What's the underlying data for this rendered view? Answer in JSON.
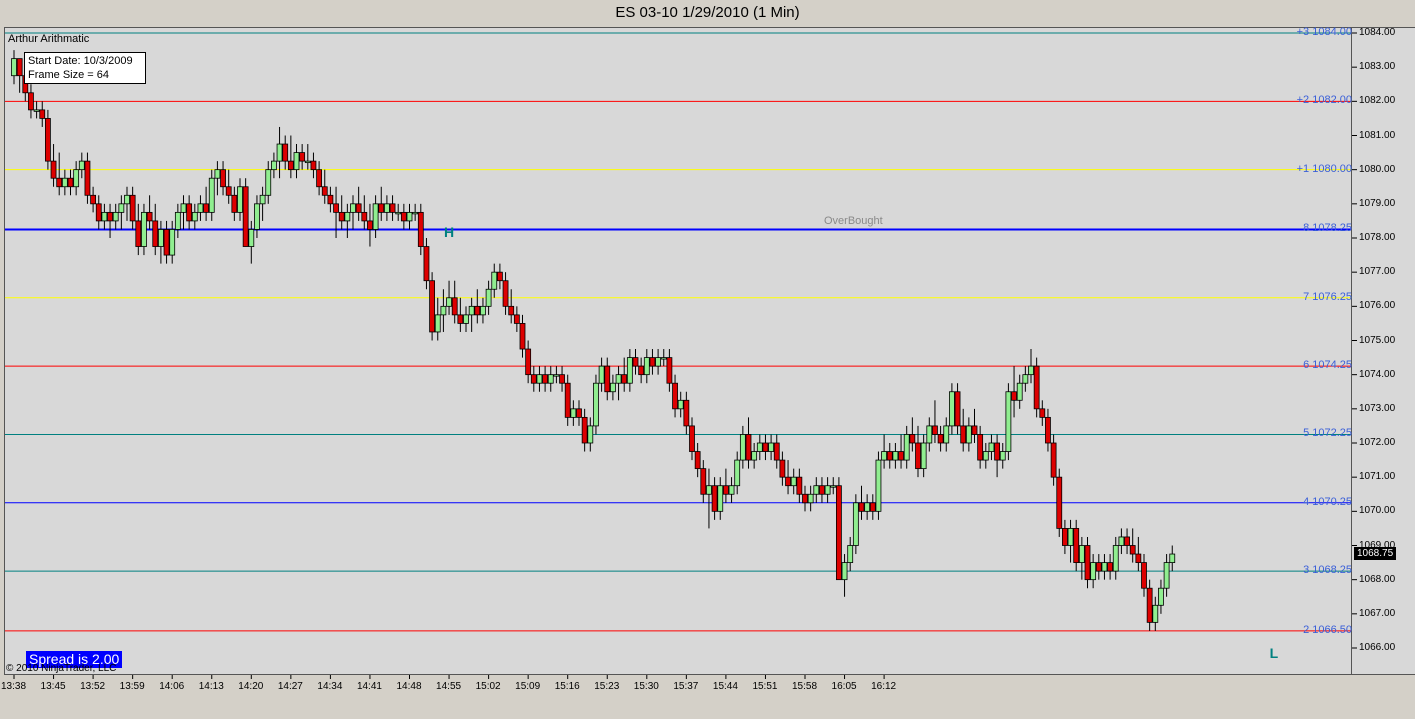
{
  "window_title": "ES 03-10  1/29/2010 (1 Min)",
  "indicator_name": "Arthur Arithmatic",
  "info_box": {
    "start_date": "Start Date: 10/3/2009",
    "frame_size": "Frame Size = 64"
  },
  "spread": "Spread is 2.00",
  "copyright": "© 2010 NinjaTrader, LLC",
  "overbought_label": "OverBought",
  "last_price": "1068.75",
  "colors": {
    "up_candle": "#90ee90",
    "down_candle": "#dd0000",
    "label_text": "#3a5fd8",
    "marker_text": "#008080"
  },
  "chart_data": {
    "type": "candlestick",
    "title": "ES 03-10  1/29/2010 (1 Min)",
    "ylim": [
      1065.5,
      1084.0
    ],
    "y_ticks": [
      "1084.00",
      "1083.00",
      "1082.00",
      "1081.00",
      "1080.00",
      "1079.00",
      "1078.00",
      "1077.00",
      "1076.00",
      "1075.00",
      "1074.00",
      "1073.00",
      "1072.00",
      "1071.00",
      "1070.00",
      "1069.00",
      "1068.00",
      "1067.00",
      "1066.00"
    ],
    "x_ticks": [
      "13:38",
      "13:45",
      "13:52",
      "13:59",
      "14:06",
      "14:13",
      "14:20",
      "14:27",
      "14:34",
      "14:41",
      "14:48",
      "14:55",
      "15:02",
      "15:09",
      "15:16",
      "15:23",
      "15:30",
      "15:37",
      "15:44",
      "15:51",
      "15:58",
      "16:05",
      "16:12"
    ],
    "levels": [
      {
        "label": "+3 1084.00",
        "value": 1084.0,
        "color": "#008080",
        "width": 1
      },
      {
        "label": "+2 1082.00",
        "value": 1082.0,
        "color": "#ff0000",
        "width": 1
      },
      {
        "label": "+1 1080.00",
        "value": 1080.0,
        "color": "#ffff00",
        "width": 1
      },
      {
        "label": "8 1078.25",
        "value": 1078.25,
        "color": "#0000ff",
        "width": 2
      },
      {
        "label": "7 1076.25",
        "value": 1076.25,
        "color": "#ffff00",
        "width": 1
      },
      {
        "label": "6 1074.25",
        "value": 1074.25,
        "color": "#ff0000",
        "width": 1
      },
      {
        "label": "5 1072.25",
        "value": 1072.25,
        "color": "#008080",
        "width": 1
      },
      {
        "label": "4 1070.25",
        "value": 1070.25,
        "color": "#0000ff",
        "width": 1
      },
      {
        "label": "3 1068.25",
        "value": 1068.25,
        "color": "#008080",
        "width": 1
      },
      {
        "label": "2 1066.50",
        "value": 1066.5,
        "color": "#ff0000",
        "width": 1
      }
    ],
    "markers": [
      {
        "text": "H",
        "bar": 77,
        "value": 1078.0
      },
      {
        "text": "L",
        "bar": 223,
        "value": 1066.0
      }
    ],
    "bar_interval_minutes": 1,
    "ohlc": [
      [
        1082.75,
        1083.5,
        1082.5,
        1083.25
      ],
      [
        1083.25,
        1083.25,
        1082.25,
        1082.75
      ],
      [
        1082.75,
        1083.0,
        1082.0,
        1082.25
      ],
      [
        1082.25,
        1082.5,
        1081.5,
        1081.75
      ],
      [
        1081.75,
        1082.0,
        1081.5,
        1081.75
      ],
      [
        1081.75,
        1082.0,
        1081.25,
        1081.5
      ],
      [
        1081.5,
        1081.75,
        1080.0,
        1080.25
      ],
      [
        1080.25,
        1080.75,
        1079.5,
        1079.75
      ],
      [
        1079.75,
        1080.5,
        1079.25,
        1079.5
      ],
      [
        1079.5,
        1080.0,
        1079.25,
        1079.75
      ],
      [
        1079.75,
        1080.0,
        1079.25,
        1079.5
      ],
      [
        1079.5,
        1080.25,
        1079.25,
        1080.0
      ],
      [
        1080.0,
        1080.5,
        1079.75,
        1080.25
      ],
      [
        1080.25,
        1080.5,
        1079.0,
        1079.25
      ],
      [
        1079.25,
        1079.5,
        1078.75,
        1079.0
      ],
      [
        1079.0,
        1079.25,
        1078.25,
        1078.5
      ],
      [
        1078.5,
        1079.0,
        1078.25,
        1078.75
      ],
      [
        1078.75,
        1079.0,
        1078.0,
        1078.5
      ],
      [
        1078.5,
        1079.0,
        1078.25,
        1078.75
      ],
      [
        1078.75,
        1079.25,
        1078.25,
        1079.0
      ],
      [
        1079.0,
        1079.5,
        1078.5,
        1079.25
      ],
      [
        1079.25,
        1079.5,
        1078.25,
        1078.5
      ],
      [
        1078.5,
        1079.0,
        1077.5,
        1077.75
      ],
      [
        1077.75,
        1079.0,
        1077.5,
        1078.75
      ],
      [
        1078.75,
        1079.25,
        1078.25,
        1078.5
      ],
      [
        1078.5,
        1079.0,
        1077.5,
        1077.75
      ],
      [
        1077.75,
        1078.5,
        1077.25,
        1078.25
      ],
      [
        1078.25,
        1078.5,
        1077.25,
        1077.5
      ],
      [
        1077.5,
        1078.5,
        1077.25,
        1078.25
      ],
      [
        1078.25,
        1079.0,
        1078.0,
        1078.75
      ],
      [
        1078.75,
        1079.25,
        1078.25,
        1079.0
      ],
      [
        1079.0,
        1079.25,
        1078.25,
        1078.5
      ],
      [
        1078.5,
        1079.0,
        1078.25,
        1078.75
      ],
      [
        1078.75,
        1079.25,
        1078.5,
        1079.0
      ],
      [
        1079.0,
        1079.5,
        1078.5,
        1078.75
      ],
      [
        1078.75,
        1080.0,
        1078.5,
        1079.75
      ],
      [
        1079.75,
        1080.25,
        1079.25,
        1080.0
      ],
      [
        1080.0,
        1080.25,
        1079.25,
        1079.5
      ],
      [
        1079.5,
        1080.0,
        1079.0,
        1079.25
      ],
      [
        1079.25,
        1079.5,
        1078.5,
        1078.75
      ],
      [
        1078.75,
        1079.75,
        1078.5,
        1079.5
      ],
      [
        1079.5,
        1079.75,
        1077.75,
        1077.75
      ],
      [
        1077.75,
        1078.5,
        1077.25,
        1078.25
      ],
      [
        1078.25,
        1079.25,
        1078.0,
        1079.0
      ],
      [
        1079.0,
        1079.5,
        1078.5,
        1079.25
      ],
      [
        1079.25,
        1080.25,
        1079.0,
        1080.0
      ],
      [
        1080.0,
        1080.5,
        1079.75,
        1080.25
      ],
      [
        1080.25,
        1081.25,
        1079.75,
        1080.75
      ],
      [
        1080.75,
        1081.0,
        1080.0,
        1080.25
      ],
      [
        1080.25,
        1081.0,
        1079.75,
        1080.0
      ],
      [
        1080.0,
        1080.75,
        1079.75,
        1080.5
      ],
      [
        1080.5,
        1080.75,
        1080.0,
        1080.25
      ],
      [
        1080.25,
        1080.75,
        1080.0,
        1080.25
      ],
      [
        1080.25,
        1080.5,
        1079.75,
        1080.0
      ],
      [
        1080.0,
        1080.25,
        1079.25,
        1079.5
      ],
      [
        1079.5,
        1080.0,
        1079.0,
        1079.25
      ],
      [
        1079.25,
        1079.5,
        1078.75,
        1079.0
      ],
      [
        1079.0,
        1079.5,
        1078.0,
        1078.75
      ],
      [
        1078.75,
        1079.25,
        1078.25,
        1078.5
      ],
      [
        1078.5,
        1079.0,
        1078.0,
        1078.75
      ],
      [
        1078.75,
        1079.25,
        1078.25,
        1079.0
      ],
      [
        1079.0,
        1079.5,
        1078.5,
        1078.75
      ],
      [
        1078.75,
        1079.25,
        1078.25,
        1078.5
      ],
      [
        1078.5,
        1079.0,
        1077.75,
        1078.25
      ],
      [
        1078.25,
        1079.25,
        1078.0,
        1079.0
      ],
      [
        1079.0,
        1079.5,
        1078.5,
        1078.75
      ],
      [
        1078.75,
        1079.25,
        1078.5,
        1079.0
      ],
      [
        1079.0,
        1079.25,
        1078.5,
        1078.75
      ],
      [
        1078.75,
        1079.0,
        1078.5,
        1078.75
      ],
      [
        1078.75,
        1079.0,
        1078.25,
        1078.5
      ],
      [
        1078.5,
        1079.0,
        1078.25,
        1078.75
      ],
      [
        1078.75,
        1079.0,
        1078.5,
        1078.75
      ],
      [
        1078.75,
        1079.0,
        1077.5,
        1077.75
      ],
      [
        1077.75,
        1078.0,
        1076.5,
        1076.75
      ],
      [
        1076.75,
        1077.0,
        1075.0,
        1075.25
      ],
      [
        1075.25,
        1076.25,
        1075.0,
        1075.75
      ],
      [
        1075.75,
        1076.5,
        1075.25,
        1076.0
      ],
      [
        1076.0,
        1076.75,
        1075.75,
        1076.25
      ],
      [
        1076.25,
        1076.75,
        1075.5,
        1075.75
      ],
      [
        1075.75,
        1076.25,
        1075.25,
        1075.5
      ],
      [
        1075.5,
        1076.0,
        1075.25,
        1075.75
      ],
      [
        1075.75,
        1076.25,
        1075.25,
        1076.0
      ],
      [
        1076.0,
        1076.5,
        1075.5,
        1075.75
      ],
      [
        1075.75,
        1076.25,
        1075.5,
        1076.0
      ],
      [
        1076.0,
        1076.75,
        1075.75,
        1076.5
      ],
      [
        1076.5,
        1077.25,
        1076.25,
        1077.0
      ],
      [
        1077.0,
        1077.25,
        1076.5,
        1076.75
      ],
      [
        1076.75,
        1077.0,
        1075.75,
        1076.0
      ],
      [
        1076.0,
        1076.5,
        1075.5,
        1075.75
      ],
      [
        1075.75,
        1076.0,
        1075.25,
        1075.5
      ],
      [
        1075.5,
        1075.75,
        1074.5,
        1074.75
      ],
      [
        1074.75,
        1075.0,
        1073.75,
        1074.0
      ],
      [
        1074.0,
        1074.25,
        1073.5,
        1073.75
      ],
      [
        1073.75,
        1074.25,
        1073.5,
        1074.0
      ],
      [
        1074.0,
        1074.25,
        1073.5,
        1073.75
      ],
      [
        1073.75,
        1074.25,
        1073.5,
        1074.0
      ],
      [
        1074.0,
        1074.25,
        1073.75,
        1074.0
      ],
      [
        1074.0,
        1074.25,
        1073.5,
        1073.75
      ],
      [
        1073.75,
        1074.0,
        1072.5,
        1072.75
      ],
      [
        1072.75,
        1073.25,
        1072.5,
        1073.0
      ],
      [
        1073.0,
        1073.25,
        1072.5,
        1072.75
      ],
      [
        1072.75,
        1073.0,
        1071.75,
        1072.0
      ],
      [
        1072.0,
        1072.75,
        1071.75,
        1072.5
      ],
      [
        1072.5,
        1074.0,
        1072.25,
        1073.75
      ],
      [
        1073.75,
        1074.5,
        1073.5,
        1074.25
      ],
      [
        1074.25,
        1074.5,
        1073.25,
        1073.5
      ],
      [
        1073.5,
        1074.0,
        1073.25,
        1073.75
      ],
      [
        1073.75,
        1074.25,
        1073.25,
        1074.0
      ],
      [
        1074.0,
        1074.5,
        1073.5,
        1073.75
      ],
      [
        1073.75,
        1074.75,
        1073.5,
        1074.5
      ],
      [
        1074.5,
        1074.75,
        1074.0,
        1074.25
      ],
      [
        1074.25,
        1074.5,
        1073.75,
        1074.0
      ],
      [
        1074.0,
        1074.75,
        1073.75,
        1074.5
      ],
      [
        1074.5,
        1074.75,
        1074.0,
        1074.25
      ],
      [
        1074.25,
        1074.75,
        1074.0,
        1074.5
      ],
      [
        1074.5,
        1074.75,
        1074.25,
        1074.5
      ],
      [
        1074.5,
        1074.75,
        1073.5,
        1073.75
      ],
      [
        1073.75,
        1074.0,
        1072.75,
        1073.0
      ],
      [
        1073.0,
        1073.5,
        1072.75,
        1073.25
      ],
      [
        1073.25,
        1073.5,
        1072.25,
        1072.5
      ],
      [
        1072.5,
        1072.75,
        1071.5,
        1071.75
      ],
      [
        1071.75,
        1072.0,
        1071.0,
        1071.25
      ],
      [
        1071.25,
        1071.5,
        1070.25,
        1070.5
      ],
      [
        1070.5,
        1071.25,
        1069.5,
        1070.75
      ],
      [
        1070.75,
        1071.0,
        1069.75,
        1070.0
      ],
      [
        1070.0,
        1071.0,
        1069.75,
        1070.75
      ],
      [
        1070.75,
        1071.25,
        1070.25,
        1070.5
      ],
      [
        1070.5,
        1071.0,
        1070.25,
        1070.75
      ],
      [
        1070.75,
        1071.75,
        1070.5,
        1071.5
      ],
      [
        1071.5,
        1072.5,
        1071.25,
        1072.25
      ],
      [
        1072.25,
        1072.75,
        1071.25,
        1071.5
      ],
      [
        1071.5,
        1072.0,
        1071.25,
        1071.75
      ],
      [
        1071.75,
        1072.25,
        1071.5,
        1072.0
      ],
      [
        1072.0,
        1072.25,
        1071.5,
        1071.75
      ],
      [
        1071.75,
        1072.25,
        1071.5,
        1072.0
      ],
      [
        1072.0,
        1072.25,
        1071.25,
        1071.5
      ],
      [
        1071.5,
        1071.75,
        1070.75,
        1071.0
      ],
      [
        1071.0,
        1071.5,
        1070.5,
        1070.75
      ],
      [
        1070.75,
        1071.25,
        1070.5,
        1071.0
      ],
      [
        1071.0,
        1071.25,
        1070.25,
        1070.5
      ],
      [
        1070.5,
        1070.75,
        1070.0,
        1070.25
      ],
      [
        1070.25,
        1070.75,
        1070.0,
        1070.5
      ],
      [
        1070.5,
        1071.0,
        1070.25,
        1070.75
      ],
      [
        1070.75,
        1071.0,
        1070.25,
        1070.5
      ],
      [
        1070.5,
        1071.0,
        1070.25,
        1070.75
      ],
      [
        1070.75,
        1071.0,
        1070.5,
        1070.75
      ],
      [
        1070.75,
        1071.0,
        1068.0,
        1068.0
      ],
      [
        1068.0,
        1068.75,
        1067.5,
        1068.5
      ],
      [
        1068.5,
        1069.25,
        1068.25,
        1069.0
      ],
      [
        1069.0,
        1070.5,
        1068.75,
        1070.25
      ],
      [
        1070.25,
        1070.75,
        1069.75,
        1070.0
      ],
      [
        1070.0,
        1070.5,
        1069.75,
        1070.25
      ],
      [
        1070.25,
        1070.5,
        1069.75,
        1070.0
      ],
      [
        1070.0,
        1071.75,
        1069.75,
        1071.5
      ],
      [
        1071.5,
        1072.25,
        1071.25,
        1071.75
      ],
      [
        1071.75,
        1072.0,
        1071.25,
        1071.5
      ],
      [
        1071.5,
        1072.0,
        1071.25,
        1071.75
      ],
      [
        1071.75,
        1072.25,
        1071.25,
        1071.5
      ],
      [
        1071.5,
        1072.5,
        1071.25,
        1072.25
      ],
      [
        1072.25,
        1072.75,
        1071.75,
        1072.0
      ],
      [
        1072.0,
        1072.5,
        1071.0,
        1071.25
      ],
      [
        1071.25,
        1072.25,
        1071.0,
        1072.0
      ],
      [
        1072.0,
        1072.75,
        1071.75,
        1072.5
      ],
      [
        1072.5,
        1073.25,
        1072.0,
        1072.25
      ],
      [
        1072.25,
        1072.5,
        1071.75,
        1072.0
      ],
      [
        1072.0,
        1072.75,
        1071.75,
        1072.5
      ],
      [
        1072.5,
        1073.75,
        1072.25,
        1073.5
      ],
      [
        1073.5,
        1073.75,
        1072.25,
        1072.5
      ],
      [
        1072.5,
        1073.0,
        1071.75,
        1072.0
      ],
      [
        1072.0,
        1072.75,
        1071.75,
        1072.5
      ],
      [
        1072.5,
        1073.0,
        1072.0,
        1072.25
      ],
      [
        1072.25,
        1072.5,
        1071.25,
        1071.5
      ],
      [
        1071.5,
        1072.0,
        1071.25,
        1071.75
      ],
      [
        1071.75,
        1072.25,
        1071.5,
        1072.0
      ],
      [
        1072.0,
        1072.25,
        1071.0,
        1071.5
      ],
      [
        1071.5,
        1072.0,
        1071.25,
        1071.75
      ],
      [
        1071.75,
        1073.75,
        1071.5,
        1073.5
      ],
      [
        1073.5,
        1074.25,
        1072.75,
        1073.25
      ],
      [
        1073.25,
        1074.0,
        1073.0,
        1073.75
      ],
      [
        1073.75,
        1074.25,
        1073.5,
        1074.0
      ],
      [
        1074.0,
        1074.75,
        1073.75,
        1074.25
      ],
      [
        1074.25,
        1074.5,
        1072.75,
        1073.0
      ],
      [
        1073.0,
        1073.25,
        1072.5,
        1072.75
      ],
      [
        1072.75,
        1073.0,
        1071.75,
        1072.0
      ],
      [
        1072.0,
        1072.25,
        1070.75,
        1071.0
      ],
      [
        1071.0,
        1071.25,
        1069.25,
        1069.5
      ],
      [
        1069.5,
        1069.75,
        1068.75,
        1069.0
      ],
      [
        1069.0,
        1069.75,
        1068.5,
        1069.5
      ],
      [
        1069.5,
        1069.75,
        1068.25,
        1068.5
      ],
      [
        1068.5,
        1069.25,
        1068.0,
        1069.0
      ],
      [
        1069.0,
        1069.25,
        1067.75,
        1068.0
      ],
      [
        1068.0,
        1068.75,
        1067.75,
        1068.5
      ],
      [
        1068.5,
        1068.75,
        1068.0,
        1068.25
      ],
      [
        1068.25,
        1068.75,
        1068.0,
        1068.5
      ],
      [
        1068.5,
        1068.75,
        1068.0,
        1068.25
      ],
      [
        1068.25,
        1069.25,
        1068.0,
        1069.0
      ],
      [
        1069.0,
        1069.5,
        1068.75,
        1069.25
      ],
      [
        1069.25,
        1069.5,
        1068.75,
        1069.0
      ],
      [
        1069.0,
        1069.5,
        1068.5,
        1068.75
      ],
      [
        1068.75,
        1069.25,
        1068.25,
        1068.5
      ],
      [
        1068.5,
        1068.75,
        1067.5,
        1067.75
      ],
      [
        1067.75,
        1068.0,
        1066.5,
        1066.75
      ],
      [
        1066.75,
        1067.5,
        1066.5,
        1067.25
      ],
      [
        1067.25,
        1068.0,
        1067.0,
        1067.75
      ],
      [
        1067.75,
        1068.75,
        1067.5,
        1068.5
      ],
      [
        1068.5,
        1069.0,
        1068.25,
        1068.75
      ]
    ]
  }
}
